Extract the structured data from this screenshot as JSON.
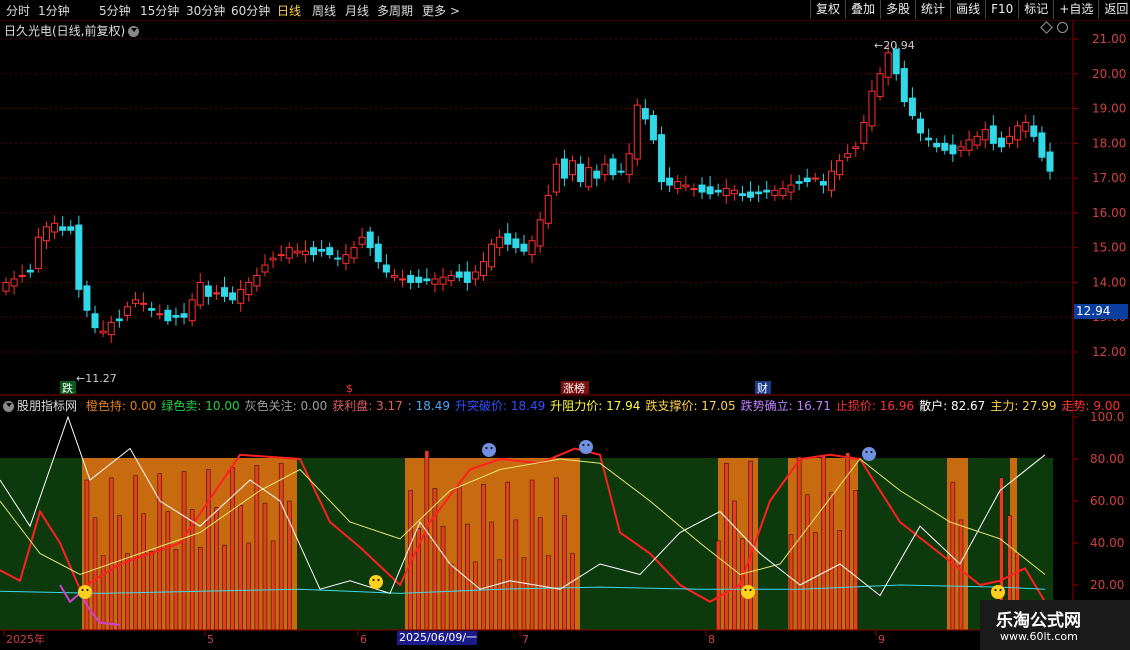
{
  "toolbar": {
    "periods": [
      "分时",
      "1分钟",
      "5分钟",
      "15分钟",
      "30分钟",
      "60分钟",
      "日线",
      "周线",
      "月线",
      "多周期",
      "更多 >"
    ],
    "active_period": "日线",
    "right_buttons": [
      "复权",
      "叠加",
      "多股",
      "统计",
      "画线",
      "F10",
      "标记",
      "+自选",
      "返回"
    ]
  },
  "stock_title": "日久光电(日线,前复权)",
  "price_axis": [
    "21.00",
    "20.00",
    "19.00",
    "18.00",
    "17.00",
    "16.00",
    "15.00",
    "14.00",
    "13.00",
    "12.00"
  ],
  "current_price": "12.94",
  "max_label": "20.94",
  "min_label": "11.27",
  "event_labels": {
    "die": "跌",
    "dollar": "$",
    "zhangbang": "涨榜",
    "cai": "财"
  },
  "indicator": {
    "name": "股朋指标网",
    "items": [
      {
        "text": "橙色持: 0.00",
        "color": "#e08020"
      },
      {
        "text": "绿色卖: 10.00",
        "color": "#20d040"
      },
      {
        "text": "灰色关注: 0.00",
        "color": "#a0a0a0"
      },
      {
        "text": "获利盘: 3.17",
        "color": "#e06060"
      },
      {
        "text": ": 18.49",
        "color": "#4aa8ff"
      },
      {
        "text": "升突破价: 18.49",
        "color": "#3050ff"
      },
      {
        "text": "升阻力价: 17.94",
        "color": "#ffff40"
      },
      {
        "text": "跌支撑价: 17.05",
        "color": "#ffd24a"
      },
      {
        "text": "跌势确立: 16.71",
        "color": "#c080ff"
      },
      {
        "text": "止损价: 16.96",
        "color": "#ff3030"
      },
      {
        "text": "散户: 82.67",
        "color": "#ffffff"
      },
      {
        "text": "主力: 27.99",
        "color": "#ffd24a"
      },
      {
        "text": "走势: 9.00",
        "color": "#ff3030"
      }
    ],
    "axis": [
      "100.0",
      "80.00",
      "60.00",
      "40.00",
      "20.00"
    ]
  },
  "date_axis": [
    "2025年",
    "5",
    "6",
    "7",
    "8",
    "9"
  ],
  "date_marker": "2025/06/09/一",
  "watermark": {
    "title": "乐淘公式网",
    "url": "www.60lt.com"
  }
}
